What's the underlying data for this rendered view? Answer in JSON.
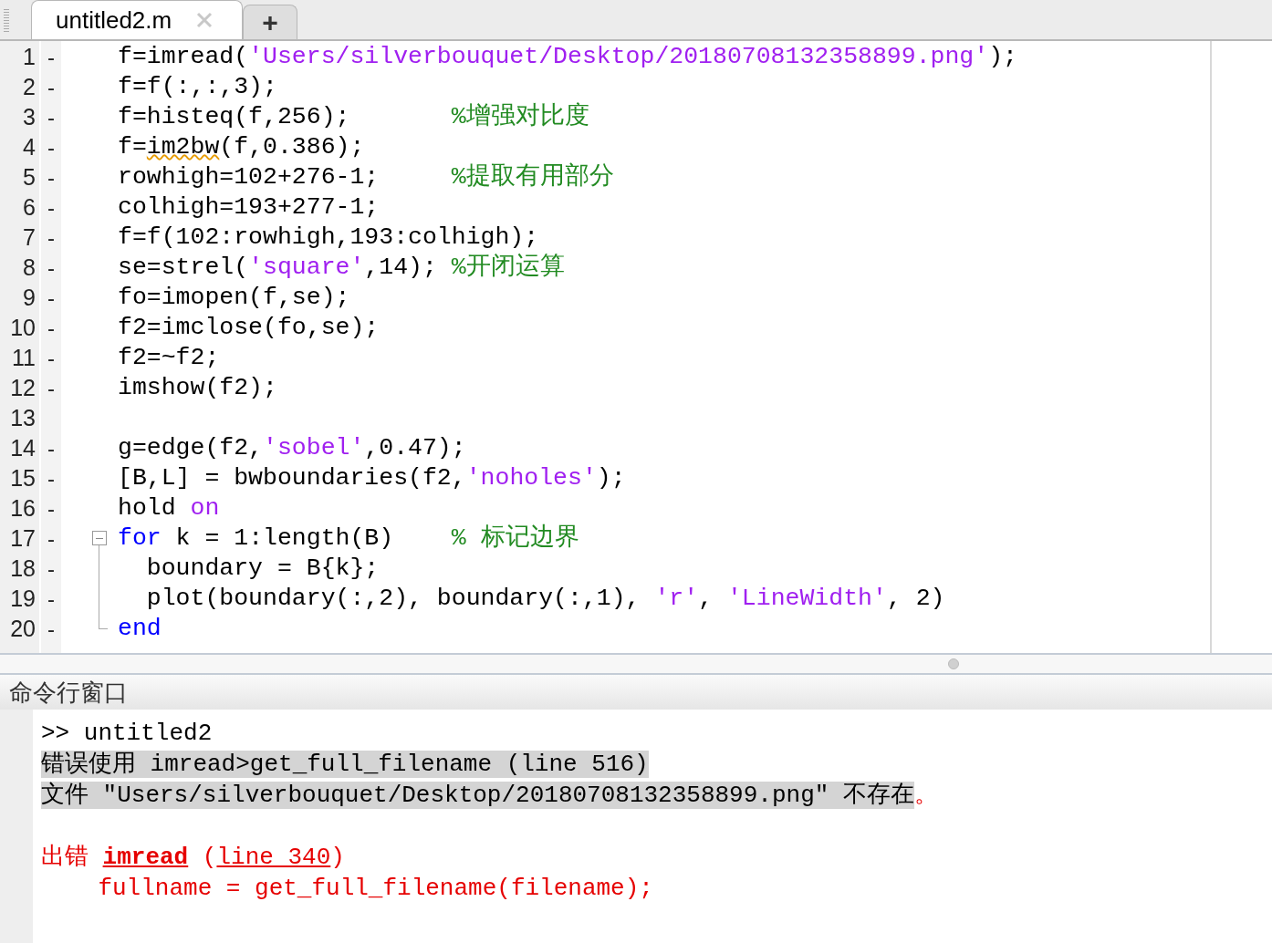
{
  "tabs": [
    {
      "label": "untitled2.m",
      "selected": true
    }
  ],
  "new_tab": "+",
  "editor": {
    "lines": [
      {
        "number": "1",
        "marker": "-",
        "tokens": [
          {
            "text": "f=imread(",
            "kind": "plain"
          },
          {
            "text": "'Users/silverbouquet/Desktop/20180708132358899.png'",
            "kind": "string"
          },
          {
            "text": ");",
            "kind": "plain"
          }
        ]
      },
      {
        "number": "2",
        "marker": "-",
        "tokens": [
          {
            "text": "f=f(:,:,3);",
            "kind": "plain"
          }
        ]
      },
      {
        "number": "3",
        "marker": "-",
        "tokens": [
          {
            "text": "f=histeq(f,256);       ",
            "kind": "plain"
          },
          {
            "text": "%增强对比度",
            "kind": "comment"
          }
        ]
      },
      {
        "number": "4",
        "marker": "-",
        "tokens": [
          {
            "text": "f=",
            "kind": "plain"
          },
          {
            "text": "im2bw",
            "kind": "flagged"
          },
          {
            "text": "(f,0.386);",
            "kind": "plain"
          }
        ]
      },
      {
        "number": "5",
        "marker": "-",
        "tokens": [
          {
            "text": "rowhigh=102+276-1;     ",
            "kind": "plain"
          },
          {
            "text": "%提取有用部分",
            "kind": "comment"
          }
        ]
      },
      {
        "number": "6",
        "marker": "-",
        "tokens": [
          {
            "text": "colhigh=193+277-1;",
            "kind": "plain"
          }
        ]
      },
      {
        "number": "7",
        "marker": "-",
        "tokens": [
          {
            "text": "f=f(102:rowhigh,193:colhigh);",
            "kind": "plain"
          }
        ]
      },
      {
        "number": "8",
        "marker": "-",
        "tokens": [
          {
            "text": "se=strel(",
            "kind": "plain"
          },
          {
            "text": "'square'",
            "kind": "string"
          },
          {
            "text": ",14); ",
            "kind": "plain"
          },
          {
            "text": "%开闭运算",
            "kind": "comment"
          }
        ]
      },
      {
        "number": "9",
        "marker": "-",
        "tokens": [
          {
            "text": "fo=imopen(f,se);",
            "kind": "plain"
          }
        ]
      },
      {
        "number": "10",
        "marker": "-",
        "tokens": [
          {
            "text": "f2=imclose(fo,se);",
            "kind": "plain"
          }
        ]
      },
      {
        "number": "11",
        "marker": "-",
        "tokens": [
          {
            "text": "f2=~f2;",
            "kind": "plain"
          }
        ]
      },
      {
        "number": "12",
        "marker": "-",
        "tokens": [
          {
            "text": "imshow(f2);",
            "kind": "plain"
          }
        ]
      },
      {
        "number": "13"
      },
      {
        "number": "14",
        "marker": "-",
        "tokens": [
          {
            "text": "g=edge(f2,",
            "kind": "plain"
          },
          {
            "text": "'sobel'",
            "kind": "string"
          },
          {
            "text": ",0.47);",
            "kind": "plain"
          }
        ]
      },
      {
        "number": "15",
        "marker": "-",
        "tokens": [
          {
            "text": "[B,L] = bwboundaries(f2,",
            "kind": "plain"
          },
          {
            "text": "'noholes'",
            "kind": "string"
          },
          {
            "text": ");",
            "kind": "plain"
          }
        ]
      },
      {
        "number": "16",
        "marker": "-",
        "tokens": [
          {
            "text": "hold ",
            "kind": "plain"
          },
          {
            "text": "on",
            "kind": "string"
          }
        ]
      },
      {
        "number": "17",
        "marker": "-",
        "kind": "fold_start",
        "tokens": [
          {
            "text": "for",
            "kind": "keyword"
          },
          {
            "text": " k = 1:length(B)    ",
            "kind": "plain"
          },
          {
            "text": "% 标记边界",
            "kind": "comment"
          }
        ]
      },
      {
        "number": "18",
        "marker": "-",
        "kind": "fold_body",
        "tokens": [
          {
            "text": "  boundary = B{k};",
            "kind": "plain"
          }
        ]
      },
      {
        "number": "19",
        "marker": "-",
        "kind": "fold_body",
        "tokens": [
          {
            "text": "  plot(boundary(:,2), boundary(:,1), ",
            "kind": "plain"
          },
          {
            "text": "'r'",
            "kind": "string"
          },
          {
            "text": ", ",
            "kind": "plain"
          },
          {
            "text": "'LineWidth'",
            "kind": "string"
          },
          {
            "text": ", 2)",
            "kind": "plain"
          }
        ]
      },
      {
        "number": "20",
        "marker": "-",
        "kind": "fold_end",
        "tokens": [
          {
            "text": "end",
            "kind": "keyword"
          }
        ]
      }
    ]
  },
  "command_window": {
    "title": "命令行窗口",
    "lines": [
      {
        "segments": [
          {
            "text": ">> untitled2",
            "kind": "plain"
          }
        ]
      },
      {
        "segments": [
          {
            "text": "错误使用 imread>get_full_filename (line 516)",
            "kind": "highlight"
          }
        ]
      },
      {
        "segments": [
          {
            "text": "文件 \"Users/silverbouquet/Desktop/20180708132358899.png\" 不存在",
            "kind": "highlight"
          },
          {
            "text": "。",
            "kind": "error"
          }
        ]
      },
      {
        "kind": "blank"
      },
      {
        "segments": [
          {
            "text": "出错 ",
            "kind": "error"
          },
          {
            "text": "imread",
            "kind": "bold_link"
          },
          {
            "text": " (",
            "kind": "error"
          },
          {
            "text": "line 340",
            "kind": "link"
          },
          {
            "text": ")",
            "kind": "error"
          }
        ]
      },
      {
        "segments": [
          {
            "text": "    fullname = get_full_filename(filename);",
            "kind": "error"
          }
        ]
      }
    ]
  }
}
